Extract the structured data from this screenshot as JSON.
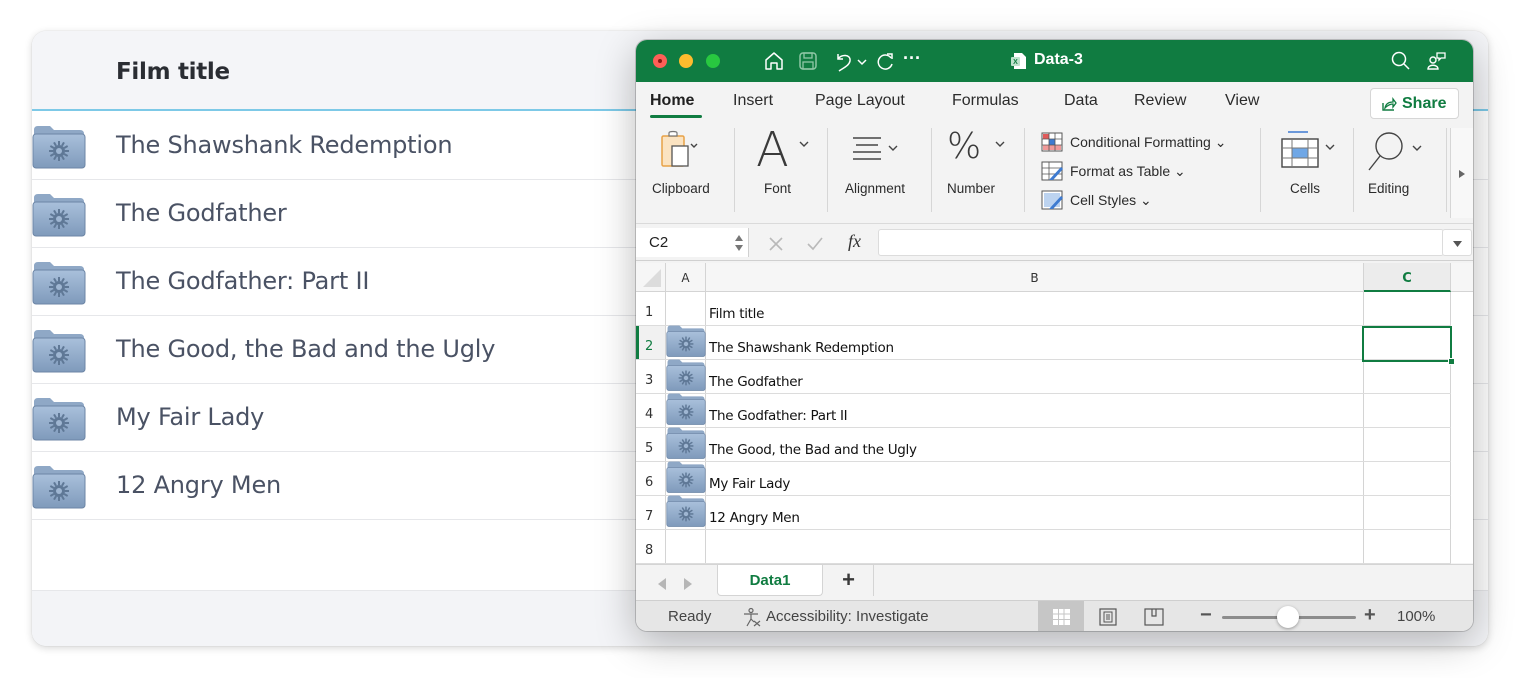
{
  "background_table": {
    "header": "Film title",
    "rows": [
      "The Shawshank Redemption",
      "The Godfather",
      "The Godfather: Part II",
      "The Good, the Bad and the Ugly",
      "My Fair Lady",
      "12 Angry Men"
    ],
    "row_icon": "folder-gear-icon"
  },
  "excel": {
    "document_title": "Data-3",
    "titlebar_icons": [
      "home-icon",
      "save-icon",
      "undo-icon",
      "chevron-down-icon",
      "redo-icon",
      "more-icon",
      "search-icon",
      "collaborate-icon"
    ],
    "more_label": "···",
    "tabs": [
      "Home",
      "Insert",
      "Page Layout",
      "Formulas",
      "Data",
      "Review",
      "View"
    ],
    "active_tab": "Home",
    "share_label": "Share",
    "ribbon": {
      "clipboard": "Clipboard",
      "font": "Font",
      "alignment": "Alignment",
      "number": "Number",
      "number_glyph": "%",
      "font_glyph": "A",
      "conditional_formatting": "Conditional Formatting",
      "format_as_table": "Format as Table",
      "cell_styles": "Cell Styles",
      "cells": "Cells",
      "editing": "Editing"
    },
    "formula_bar": {
      "name_box": "C2",
      "fx_label": "fx",
      "formula_value": ""
    },
    "columns": [
      "A",
      "B",
      "C"
    ],
    "selected_column": "C",
    "selected_cell": "C2",
    "rows": [
      {
        "num": "1",
        "b": "Film title",
        "has_icon": false
      },
      {
        "num": "2",
        "b": "The Shawshank Redemption",
        "has_icon": true
      },
      {
        "num": "3",
        "b": "The Godfather",
        "has_icon": true
      },
      {
        "num": "4",
        "b": "The Godfather: Part II",
        "has_icon": true
      },
      {
        "num": "5",
        "b": "The Good, the Bad and the Ugly",
        "has_icon": true
      },
      {
        "num": "6",
        "b": "My Fair Lady",
        "has_icon": true
      },
      {
        "num": "7",
        "b": "12 Angry Men",
        "has_icon": true
      },
      {
        "num": "8",
        "b": "",
        "has_icon": false
      }
    ],
    "sheet_tabs": [
      "Data1"
    ],
    "add_sheet_label": "+",
    "status": {
      "ready": "Ready",
      "accessibility": "Accessibility: Investigate",
      "zoom_minus": "−",
      "zoom_plus": "+",
      "zoom_level": "100%",
      "zoom_slider_fraction": 0.5
    },
    "colors": {
      "accent": "#107c41",
      "bg_header_underline": "#7dc9e7"
    }
  }
}
